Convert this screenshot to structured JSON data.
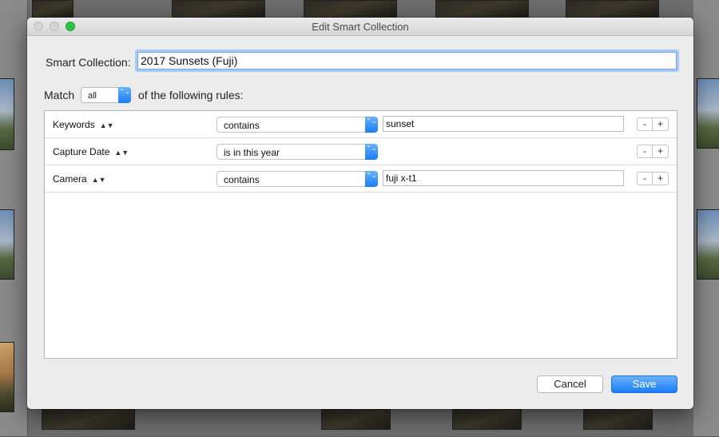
{
  "dialog": {
    "title": "Edit Smart Collection",
    "name_label": "Smart Collection:",
    "name_value": "2017 Sunsets (Fuji)",
    "match_label": "Match",
    "match_value": "all",
    "following_label": "of the following rules:",
    "stepper_glyph": "⌃⌄",
    "rules": [
      {
        "field": "Keywords",
        "operator": "contains",
        "value": "sunset",
        "has_value": true
      },
      {
        "field": "Capture Date",
        "operator": "is in this year",
        "value": "",
        "has_value": false
      },
      {
        "field": "Camera",
        "operator": "contains",
        "value": "fuji x-t1",
        "has_value": true
      }
    ],
    "field_arrows": "▲▼",
    "remove_label": "-",
    "add_label": "+",
    "cancel_label": "Cancel",
    "save_label": "Save"
  },
  "colors": {
    "accent": "#1b7ef7",
    "focus_ring": "#a6c8f3",
    "zoom_button": "#2ec342"
  },
  "icons": {
    "window_close": "traffic-light-close-icon",
    "window_minimize": "traffic-light-minimize-icon",
    "window_zoom": "traffic-light-zoom-icon",
    "select_stepper": "chevron-up-down-icon",
    "field_sort": "up-down-arrows-icon"
  }
}
